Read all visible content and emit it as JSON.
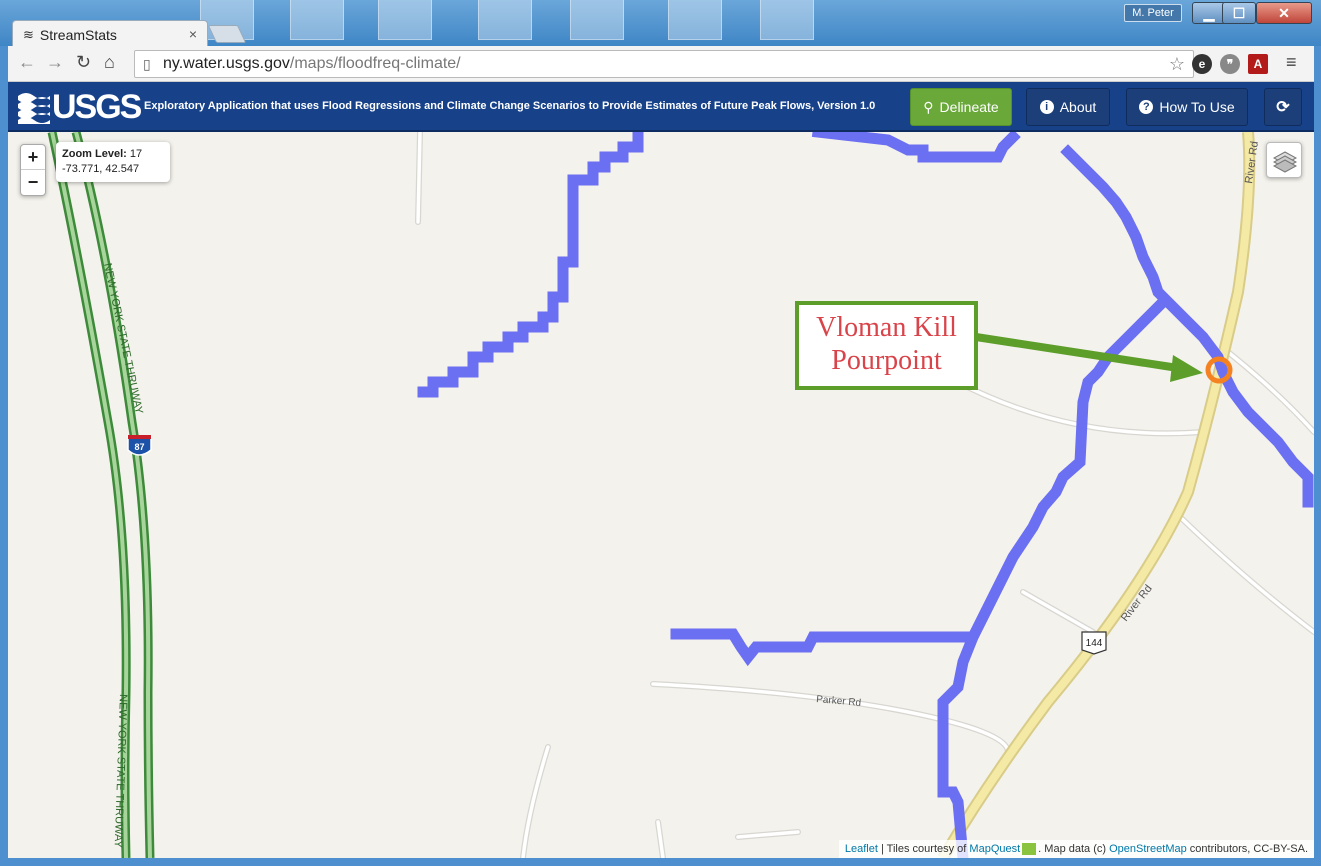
{
  "browser": {
    "tab_title": "StreamStats",
    "url_host": "ny.water.usgs.gov",
    "url_path": "/maps/floodfreq-climate/",
    "user_badge": "M. Peter"
  },
  "header": {
    "logo_text": "USGS",
    "app_title": "Exploratory Application that uses Flood Regressions and Climate Change Scenarios to Provide Estimates of Future Peak Flows, Version 1.0",
    "buttons": {
      "delineate": "Delineate",
      "about": "About",
      "how_to_use": "How To Use"
    },
    "colors": {
      "bar": "#17428a",
      "delineate": "#6aa83a"
    }
  },
  "map": {
    "zoom_label": "Zoom Level:",
    "zoom_value": "17",
    "coords": "-73.771, 42.547",
    "callout_line1": "Vloman Kill",
    "callout_line2": "Pourpoint",
    "road_labels": {
      "thruway": "NEW YORK STATE THRUWAY",
      "interstate": "87",
      "route": "144",
      "river_rd": "River Rd",
      "parker_rd": "Parker Rd"
    },
    "attribution": {
      "leaflet": "Leaflet",
      "tiles": " | Tiles courtesy of ",
      "mapquest": "MapQuest",
      "mapdata": ". Map data (c) ",
      "osm": "OpenStreetMap",
      "license": " contributors, CC-BY-SA."
    },
    "colors": {
      "stream": "#6b6ff2",
      "highway": "#3d8a3a",
      "major_road": "#f3e6a0",
      "pourpoint": "#f58220",
      "callout_border": "#5d9e2b",
      "callout_text": "#d9434a"
    }
  }
}
